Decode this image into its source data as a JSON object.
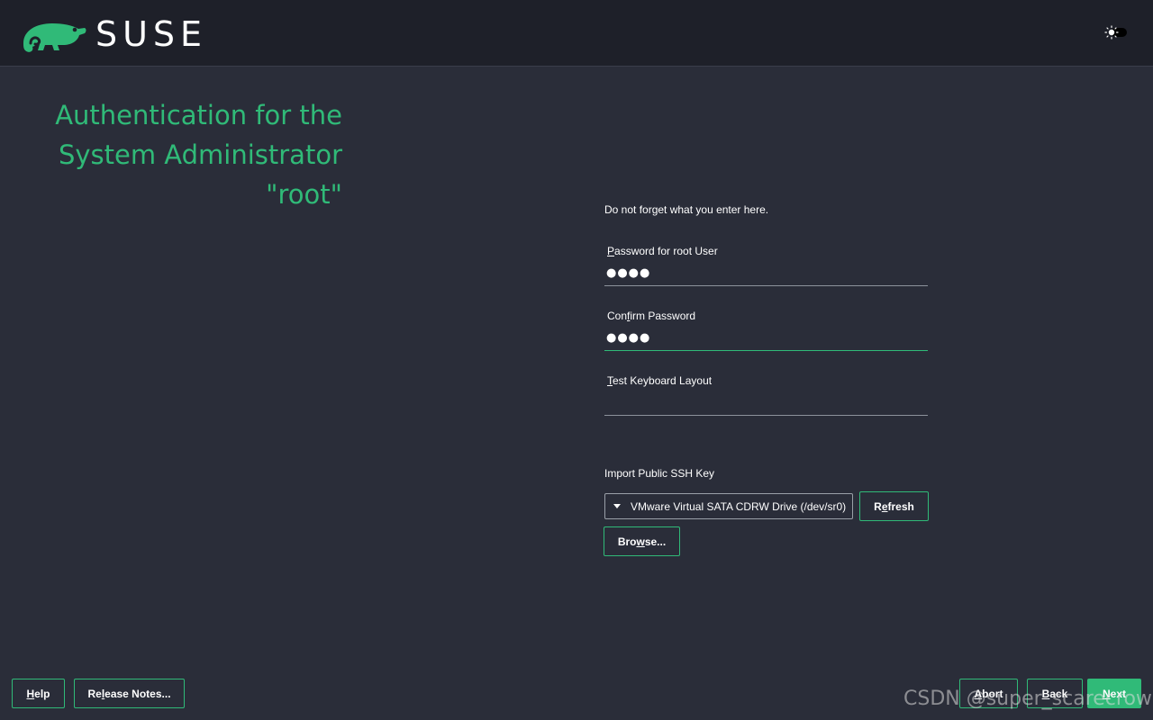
{
  "header": {
    "brand": "SUSE",
    "logo_icon": "chameleon-logo-icon",
    "theme_toggle_icon": "sun-theme-toggle-icon"
  },
  "title": {
    "line1": "Authentication for the",
    "line2": "System Administrator",
    "line3": "\"root\""
  },
  "hint": "Do not forget what you enter here.",
  "password": {
    "label_mn": "P",
    "label_rest": "assword for root User",
    "value": "●●●●"
  },
  "confirm": {
    "label_pre": "Con",
    "label_mn": "f",
    "label_rest": "irm Password",
    "value": "●●●●"
  },
  "keyboard": {
    "label_mn": "T",
    "label_rest": "est Keyboard Layout",
    "value": ""
  },
  "ssh": {
    "label": "Import Public SSH Key",
    "selected_device": "VMware Virtual SATA CDRW Drive (/dev/sr0)",
    "refresh_pre": "R",
    "refresh_mn": "e",
    "refresh_rest": "fresh",
    "browse_pre": "Bro",
    "browse_mn": "w",
    "browse_rest": "se..."
  },
  "footer": {
    "help_mn": "H",
    "help_rest": "elp",
    "release_pre": "Re",
    "release_mn": "l",
    "release_rest": "ease Notes...",
    "abort_mn": "A",
    "abort_rest": "bort",
    "back_mn": "B",
    "back_rest": "ack",
    "next_mn": "N",
    "next_rest": "ext"
  },
  "watermark": "CSDN @super_scarecrow",
  "colors": {
    "accent": "#30ba78",
    "background": "#2a2d39",
    "header_background": "#1e2029"
  }
}
